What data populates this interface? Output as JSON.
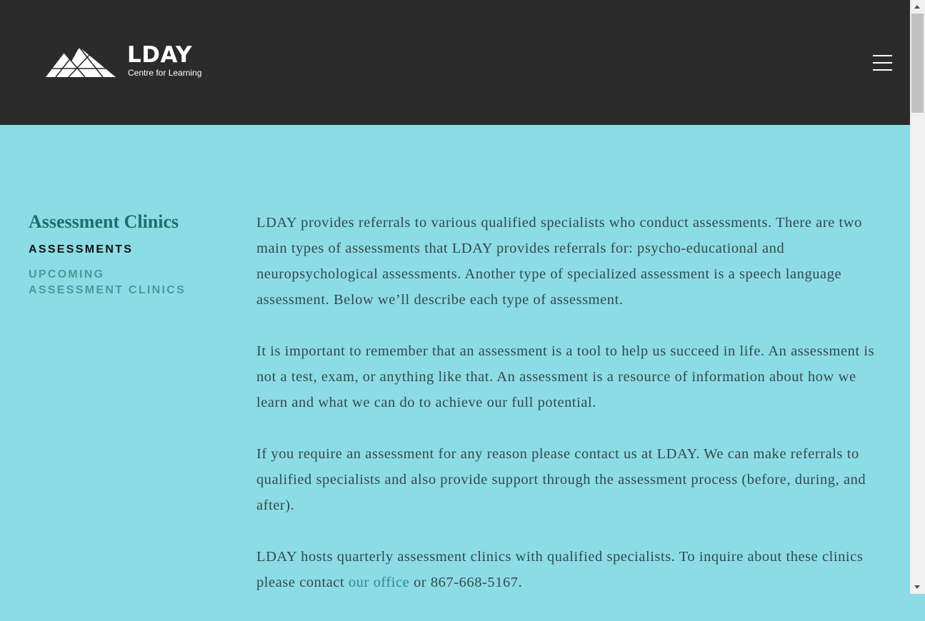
{
  "header": {
    "logo_title": "LDAY",
    "logo_subtitle": "Centre for Learning",
    "menu_icon": "hamburger-menu-icon"
  },
  "sidebar": {
    "title": "Assessment Clinics",
    "items": [
      {
        "label": "Assessments",
        "active": true
      },
      {
        "label": "Upcoming Assessment Clinics",
        "active": false
      }
    ]
  },
  "content": {
    "paragraphs": [
      "LDAY provides referrals to various qualified specialists who conduct assessments. There are two main types of assessments that LDAY provides referrals for: psycho-educational and neuropsychological assessments. Another type of specialized assessment is a speech language assessment. Below we’ll describe each type of assessment.",
      "It is important to remember that an assessment is a tool to help us succeed in life. An assessment is not a test, exam, or anything like that. An assessment is a resource of information about how we learn and what we can do to achieve our full potential.",
      "If you require an assessment for any reason please contact us at LDAY. We can make referrals to qualified specialists and also provide support through the assessment process (before, during, and after)."
    ],
    "last_paragraph": {
      "before_link": "LDAY hosts quarterly assessment clinics with qualified specialists. To inquire about these clinics please contact ",
      "link_text": "our office",
      "after_link": " or 867-668-5167."
    }
  },
  "colors": {
    "header_bg": "#2b2b2b",
    "page_bg": "#8cdce6",
    "accent_teal": "#1b6f6a",
    "link_teal": "#2f8a85",
    "body_text": "#35484a"
  }
}
